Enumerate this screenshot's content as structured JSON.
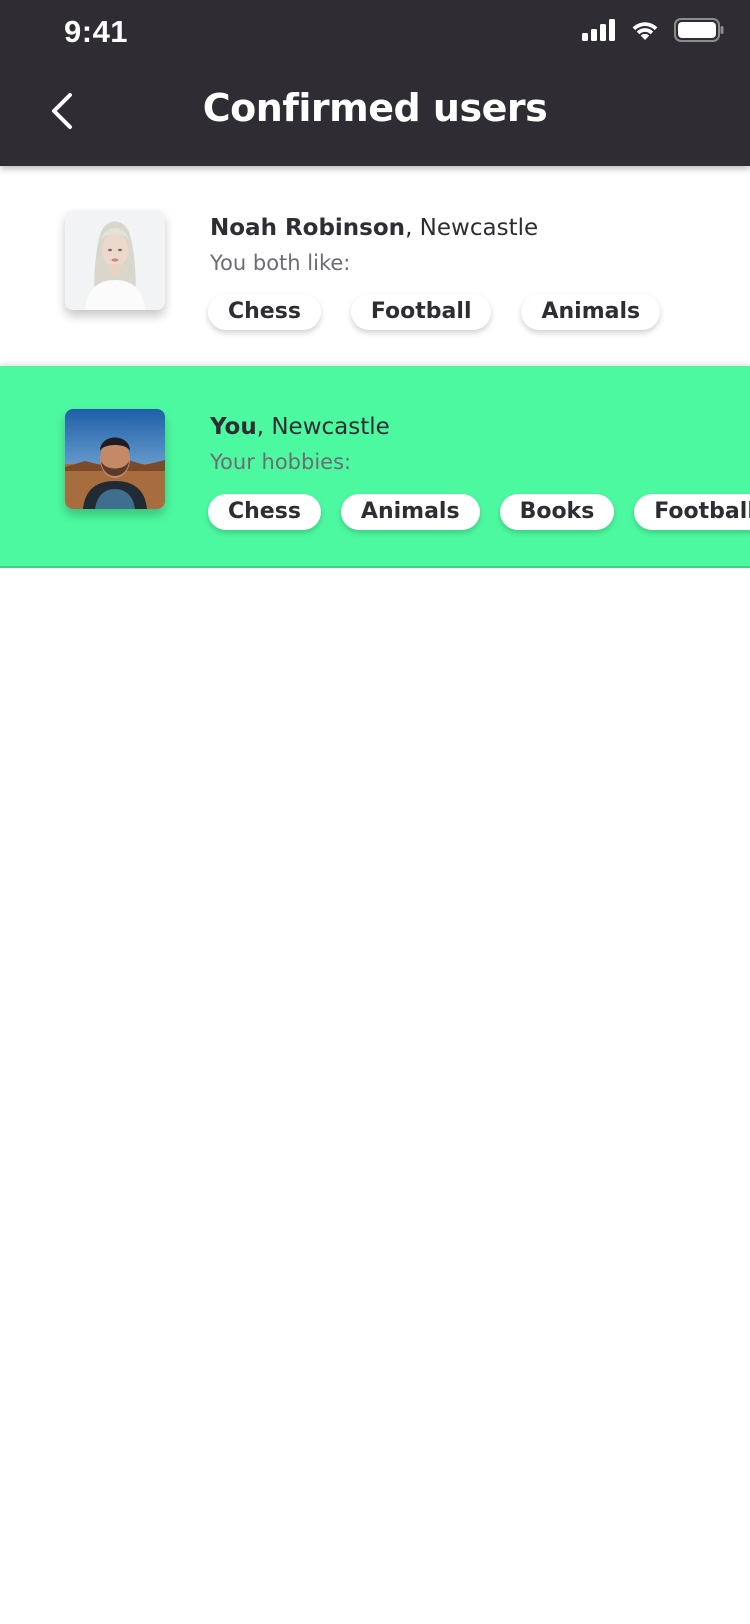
{
  "status_bar": {
    "time": "9:41"
  },
  "header": {
    "title": "Confirmed users"
  },
  "users": [
    {
      "name": "Noah Robinson",
      "location": ", Newcastle",
      "subtitle": "You both like:",
      "tags": [
        "Chess",
        "Football",
        "Animals"
      ]
    },
    {
      "name": "You",
      "location": ", Newcastle",
      "subtitle": "Your hobbies:",
      "tags": [
        "Chess",
        "Animals",
        "Books",
        "Football"
      ]
    }
  ],
  "colors": {
    "header_bg": "#2f2d33",
    "highlight_bg": "#4cf9a0",
    "text_dark": "#2f2d33"
  }
}
